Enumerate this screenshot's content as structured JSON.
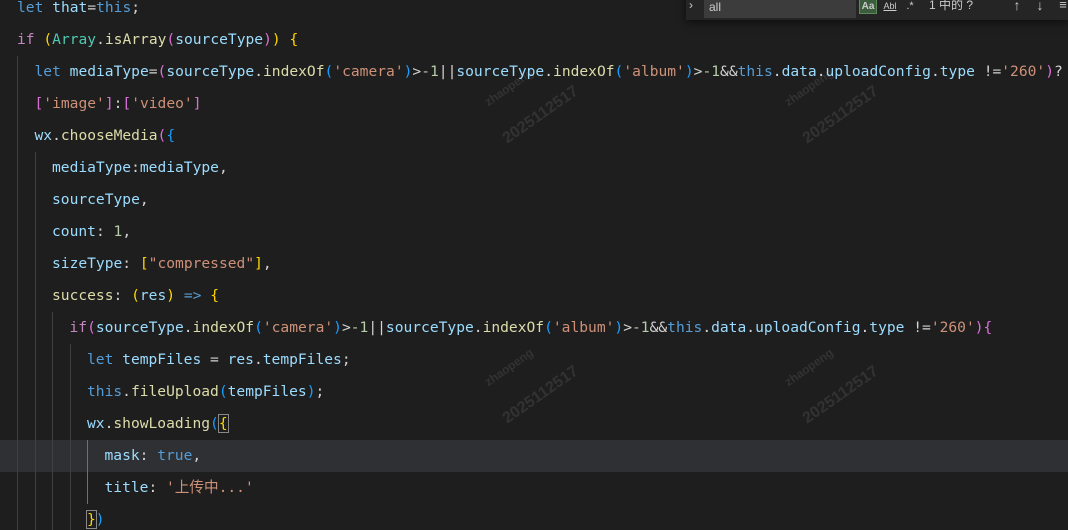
{
  "find_widget": {
    "query": "all",
    "match_case_label": "Aa",
    "whole_word_label": "Abl",
    "regex_label": ".*",
    "result_count": "1 中的 ?",
    "prev_icon": "arrow-up-icon",
    "next_icon": "arrow-down-icon",
    "selection_icon": "find-in-selection-icon"
  },
  "watermark": {
    "name": "zhaopeng",
    "date": "2025112517"
  },
  "code_lines": [
    {
      "indent": 0,
      "guides": 0,
      "tokens": [
        [
          "t-kw",
          "let "
        ],
        [
          "t-var",
          "that"
        ],
        [
          "t-op",
          "="
        ],
        [
          "t-kw",
          "this"
        ],
        [
          "t-op",
          ";"
        ]
      ]
    },
    {
      "indent": 0,
      "guides": 0,
      "tokens": [
        [
          "t-ctl",
          "if "
        ],
        [
          "t-b1",
          "("
        ],
        [
          "t-cls",
          "Array"
        ],
        [
          "t-op",
          "."
        ],
        [
          "t-fn",
          "isArray"
        ],
        [
          "t-b2",
          "("
        ],
        [
          "t-var",
          "sourceType"
        ],
        [
          "t-b2",
          ")"
        ],
        [
          "t-b1",
          ")"
        ],
        [
          "t-op",
          " "
        ],
        [
          "t-b1",
          "{"
        ]
      ]
    },
    {
      "indent": 1,
      "guides": 1,
      "tokens": [
        [
          "t-kw",
          "let "
        ],
        [
          "t-var",
          "mediaType"
        ],
        [
          "t-op",
          "="
        ],
        [
          "t-b2",
          "("
        ],
        [
          "t-var",
          "sourceType"
        ],
        [
          "t-op",
          "."
        ],
        [
          "t-fn",
          "indexOf"
        ],
        [
          "t-b3",
          "("
        ],
        [
          "t-str",
          "'camera'"
        ],
        [
          "t-b3",
          ")"
        ],
        [
          "t-op",
          ">"
        ],
        [
          "t-num",
          "-1"
        ],
        [
          "t-op",
          "||"
        ],
        [
          "t-var",
          "sourceType"
        ],
        [
          "t-op",
          "."
        ],
        [
          "t-fn",
          "indexOf"
        ],
        [
          "t-b3",
          "("
        ],
        [
          "t-str",
          "'album'"
        ],
        [
          "t-b3",
          ")"
        ],
        [
          "t-op",
          ">"
        ],
        [
          "t-num",
          "-1"
        ],
        [
          "t-op",
          "&&"
        ],
        [
          "t-kw",
          "this"
        ],
        [
          "t-op",
          "."
        ],
        [
          "t-var",
          "data"
        ],
        [
          "t-op",
          "."
        ],
        [
          "t-var",
          "uploadConfig"
        ],
        [
          "t-op",
          "."
        ],
        [
          "t-var",
          "type"
        ],
        [
          "t-op",
          " !="
        ],
        [
          "t-str",
          "'260'"
        ],
        [
          "t-b2",
          ")"
        ],
        [
          "t-op",
          "?"
        ]
      ]
    },
    {
      "indent": 1,
      "guides": 1,
      "tokens": [
        [
          "t-b2",
          "["
        ],
        [
          "t-str",
          "'image'"
        ],
        [
          "t-b2",
          "]"
        ],
        [
          "t-op",
          ":"
        ],
        [
          "t-b2",
          "["
        ],
        [
          "t-str",
          "'video'"
        ],
        [
          "t-b2",
          "]"
        ]
      ]
    },
    {
      "indent": 1,
      "guides": 1,
      "tokens": [
        [
          "t-var",
          "wx"
        ],
        [
          "t-op",
          "."
        ],
        [
          "t-fn",
          "chooseMedia"
        ],
        [
          "t-b2",
          "("
        ],
        [
          "t-b3",
          "{"
        ]
      ]
    },
    {
      "indent": 2,
      "guides": 2,
      "tokens": [
        [
          "t-var",
          "mediaType"
        ],
        [
          "t-op",
          ":"
        ],
        [
          "t-var",
          "mediaType"
        ],
        [
          "t-op",
          ","
        ]
      ]
    },
    {
      "indent": 2,
      "guides": 2,
      "tokens": [
        [
          "t-var",
          "sourceType"
        ],
        [
          "t-op",
          ","
        ]
      ]
    },
    {
      "indent": 2,
      "guides": 2,
      "tokens": [
        [
          "t-var",
          "count"
        ],
        [
          "t-op",
          ": "
        ],
        [
          "t-num",
          "1"
        ],
        [
          "t-op",
          ","
        ]
      ]
    },
    {
      "indent": 2,
      "guides": 2,
      "tokens": [
        [
          "t-var",
          "sizeType"
        ],
        [
          "t-op",
          ": "
        ],
        [
          "t-b1",
          "["
        ],
        [
          "t-str",
          "\"compressed\""
        ],
        [
          "t-b1",
          "]"
        ],
        [
          "t-op",
          ","
        ]
      ]
    },
    {
      "indent": 2,
      "guides": 2,
      "tokens": [
        [
          "t-fn",
          "success"
        ],
        [
          "t-op",
          ": "
        ],
        [
          "t-b1",
          "("
        ],
        [
          "t-var",
          "res"
        ],
        [
          "t-b1",
          ")"
        ],
        [
          "t-op",
          " "
        ],
        [
          "t-kw",
          "=>"
        ],
        [
          "t-op",
          " "
        ],
        [
          "t-b1",
          "{"
        ]
      ]
    },
    {
      "indent": 3,
      "guides": 3,
      "tokens": [
        [
          "t-ctl",
          "if"
        ],
        [
          "t-b2",
          "("
        ],
        [
          "t-var",
          "sourceType"
        ],
        [
          "t-op",
          "."
        ],
        [
          "t-fn",
          "indexOf"
        ],
        [
          "t-b3",
          "("
        ],
        [
          "t-str",
          "'camera'"
        ],
        [
          "t-b3",
          ")"
        ],
        [
          "t-op",
          ">"
        ],
        [
          "t-num",
          "-1"
        ],
        [
          "t-op",
          "||"
        ],
        [
          "t-var",
          "sourceType"
        ],
        [
          "t-op",
          "."
        ],
        [
          "t-fn",
          "indexOf"
        ],
        [
          "t-b3",
          "("
        ],
        [
          "t-str",
          "'album'"
        ],
        [
          "t-b3",
          ")"
        ],
        [
          "t-op",
          ">"
        ],
        [
          "t-num",
          "-1"
        ],
        [
          "t-op",
          "&&"
        ],
        [
          "t-kw",
          "this"
        ],
        [
          "t-op",
          "."
        ],
        [
          "t-var",
          "data"
        ],
        [
          "t-op",
          "."
        ],
        [
          "t-var",
          "uploadConfig"
        ],
        [
          "t-op",
          "."
        ],
        [
          "t-var",
          "type"
        ],
        [
          "t-op",
          " !="
        ],
        [
          "t-str",
          "'260'"
        ],
        [
          "t-b2",
          ")"
        ],
        [
          "t-b2",
          "{"
        ]
      ]
    },
    {
      "indent": 4,
      "guides": 4,
      "tokens": [
        [
          "t-kw",
          "let "
        ],
        [
          "t-var",
          "tempFiles"
        ],
        [
          "t-op",
          " = "
        ],
        [
          "t-var",
          "res"
        ],
        [
          "t-op",
          "."
        ],
        [
          "t-var",
          "tempFiles"
        ],
        [
          "t-op",
          ";"
        ]
      ]
    },
    {
      "indent": 4,
      "guides": 4,
      "tokens": [
        [
          "t-kw",
          "this"
        ],
        [
          "t-op",
          "."
        ],
        [
          "t-fn",
          "fileUpload"
        ],
        [
          "t-b3",
          "("
        ],
        [
          "t-var",
          "tempFiles"
        ],
        [
          "t-b3",
          ")"
        ],
        [
          "t-op",
          ";"
        ]
      ]
    },
    {
      "indent": 4,
      "guides": 4,
      "tokens": [
        [
          "t-var",
          "wx"
        ],
        [
          "t-op",
          "."
        ],
        [
          "t-fn",
          "showLoading"
        ],
        [
          "t-b3",
          "("
        ],
        [
          "t-b1 cursor-box",
          "{"
        ]
      ]
    },
    {
      "indent": 5,
      "guides": 5,
      "highlight": true,
      "tokens": [
        [
          "t-var",
          "mask"
        ],
        [
          "t-op",
          ": "
        ],
        [
          "t-kw",
          "true"
        ],
        [
          "t-op",
          ","
        ]
      ]
    },
    {
      "indent": 5,
      "guides": 5,
      "tokens": [
        [
          "t-var",
          "title"
        ],
        [
          "t-op",
          ": "
        ],
        [
          "t-str",
          "'上传中...'"
        ]
      ]
    },
    {
      "indent": 4,
      "guides": 4,
      "tokens": [
        [
          "t-b1 cursor-box",
          "}"
        ],
        [
          "t-b3",
          ")"
        ]
      ]
    }
  ]
}
